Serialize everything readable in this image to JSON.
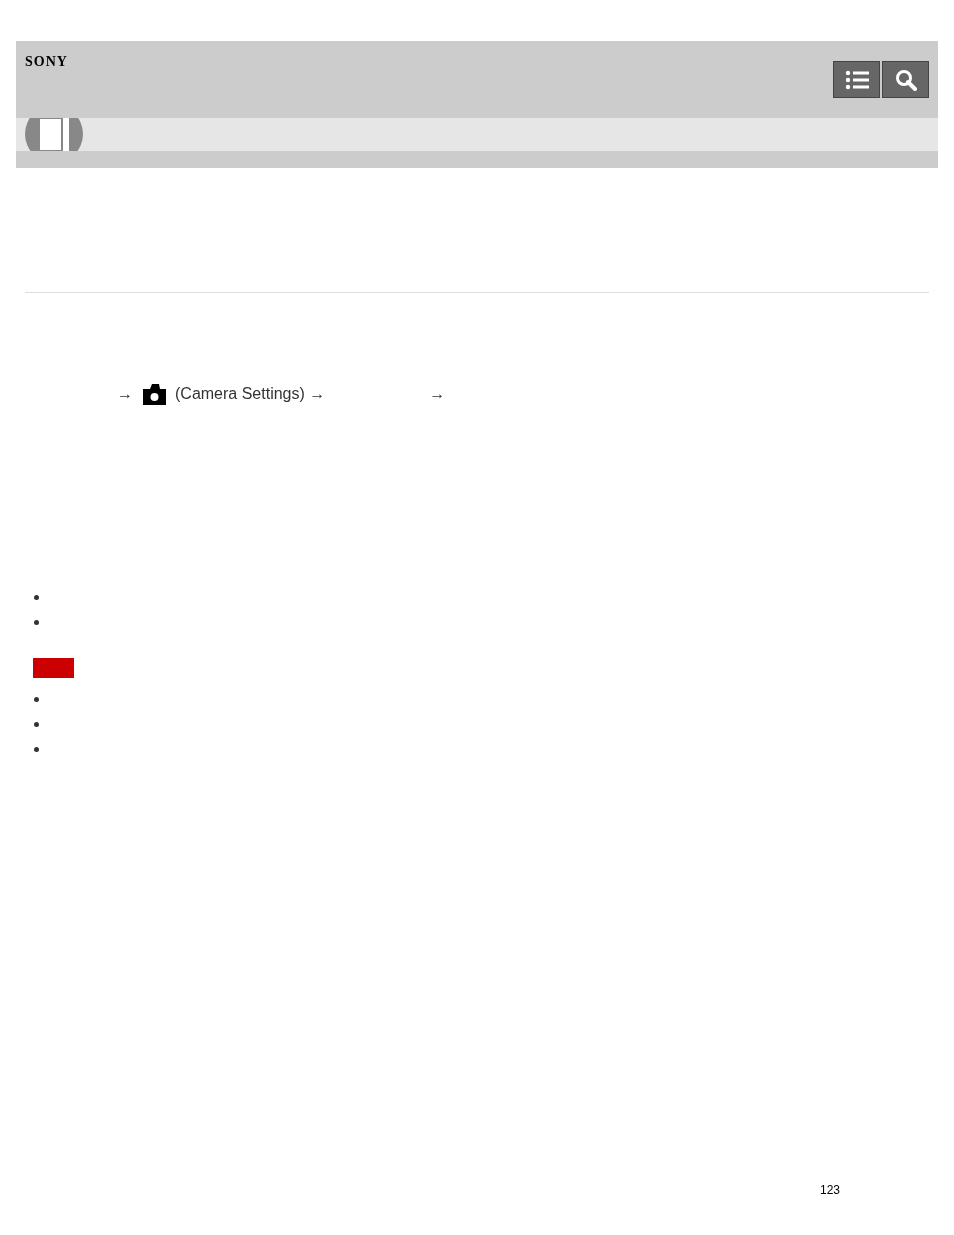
{
  "header": {
    "logo": "SONY"
  },
  "toolbar": [
    {
      "kind": "contents"
    },
    {
      "kind": "search"
    }
  ],
  "procedure": {
    "parts": [
      {
        "kind": "arrow",
        "text": "→"
      },
      {
        "kind": "camera-icon"
      },
      {
        "kind": "text",
        "text": "(Camera Settings) →"
      },
      {
        "kind": "gap"
      },
      {
        "kind": "arrow",
        "text": "→"
      }
    ]
  },
  "bullets_1": [
    {
      "kind": "bullet"
    },
    {
      "kind": "bullet"
    }
  ],
  "note": {
    "color": "#cc0000"
  },
  "bullets_2": [
    {
      "kind": "bullet"
    },
    {
      "kind": "bullet"
    },
    {
      "kind": "bullet"
    }
  ],
  "page_number": "123"
}
